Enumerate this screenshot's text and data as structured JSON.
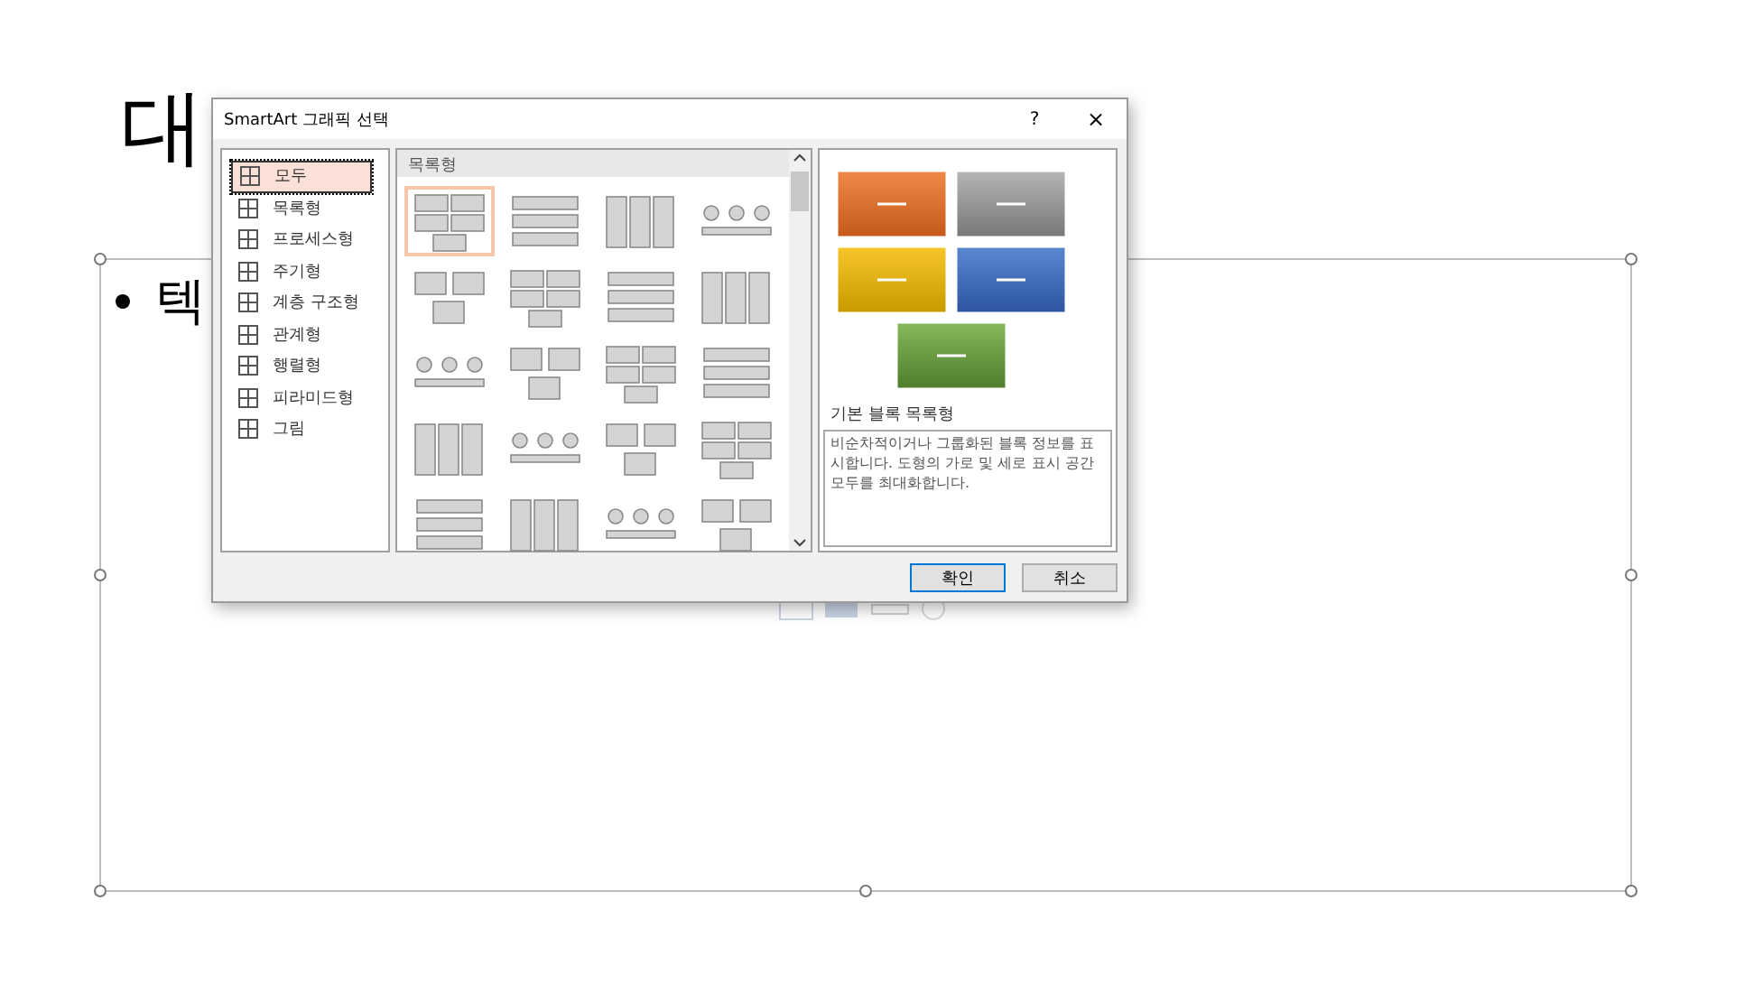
{
  "slide": {
    "title": "대",
    "bullet": "텍"
  },
  "dialog": {
    "title": "SmartArt 그래픽 선택",
    "help": "?",
    "close": "×",
    "categories": [
      {
        "label": "모두",
        "selected": true
      },
      {
        "label": "목록형",
        "selected": false
      },
      {
        "label": "프로세스형",
        "selected": false
      },
      {
        "label": "주기형",
        "selected": false
      },
      {
        "label": "계층 구조형",
        "selected": false
      },
      {
        "label": "관계형",
        "selected": false
      },
      {
        "label": "행렬형",
        "selected": false
      },
      {
        "label": "피라미드형",
        "selected": false
      },
      {
        "label": "그림",
        "selected": false
      }
    ],
    "gallery": {
      "heading": "목록형",
      "items": [
        {
          "selected": true
        },
        {
          "selected": false
        },
        {
          "selected": false
        },
        {
          "selected": false
        },
        {
          "selected": false
        },
        {
          "selected": false
        },
        {
          "selected": false
        },
        {
          "selected": false
        },
        {
          "selected": false
        },
        {
          "selected": false
        },
        {
          "selected": false
        },
        {
          "selected": false
        },
        {
          "selected": false
        },
        {
          "selected": false
        },
        {
          "selected": false
        },
        {
          "selected": false
        },
        {
          "selected": false
        },
        {
          "selected": false
        },
        {
          "selected": false
        },
        {
          "selected": false
        }
      ]
    },
    "preview": {
      "name": "기본 블록 목록형",
      "description": "비순차적이거나 그룹화된 블록 정보를 표시합니다. 도형의 가로 및 세로 표시 공간 모두를 최대화합니다."
    },
    "buttons": [
      {
        "label": "확인",
        "kind": "default"
      },
      {
        "label": "취소",
        "kind": "normal"
      }
    ]
  }
}
